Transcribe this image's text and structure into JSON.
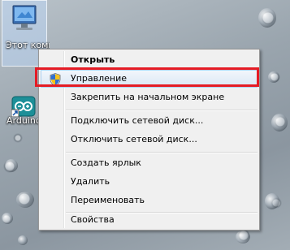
{
  "desktop": {
    "this_pc_label": "Этот компьютер",
    "arduino_label": "Arduino"
  },
  "context_menu": {
    "items": [
      {
        "label": "Открыть",
        "bold": true
      },
      {
        "label": "Управление",
        "icon": "uac-shield-icon",
        "highlighted": true
      },
      {
        "label": "Закрепить на начальном экране"
      },
      {
        "label": "Подключить сетевой диск..."
      },
      {
        "label": "Отключить сетевой диск..."
      },
      {
        "label": "Создать ярлык"
      },
      {
        "label": "Удалить"
      },
      {
        "label": "Переименовать"
      },
      {
        "label": "Свойства"
      }
    ]
  },
  "colors": {
    "highlight_annotation": "#e51b24",
    "menu_background": "#f0f0f0",
    "hover_border": "#aecfef"
  }
}
